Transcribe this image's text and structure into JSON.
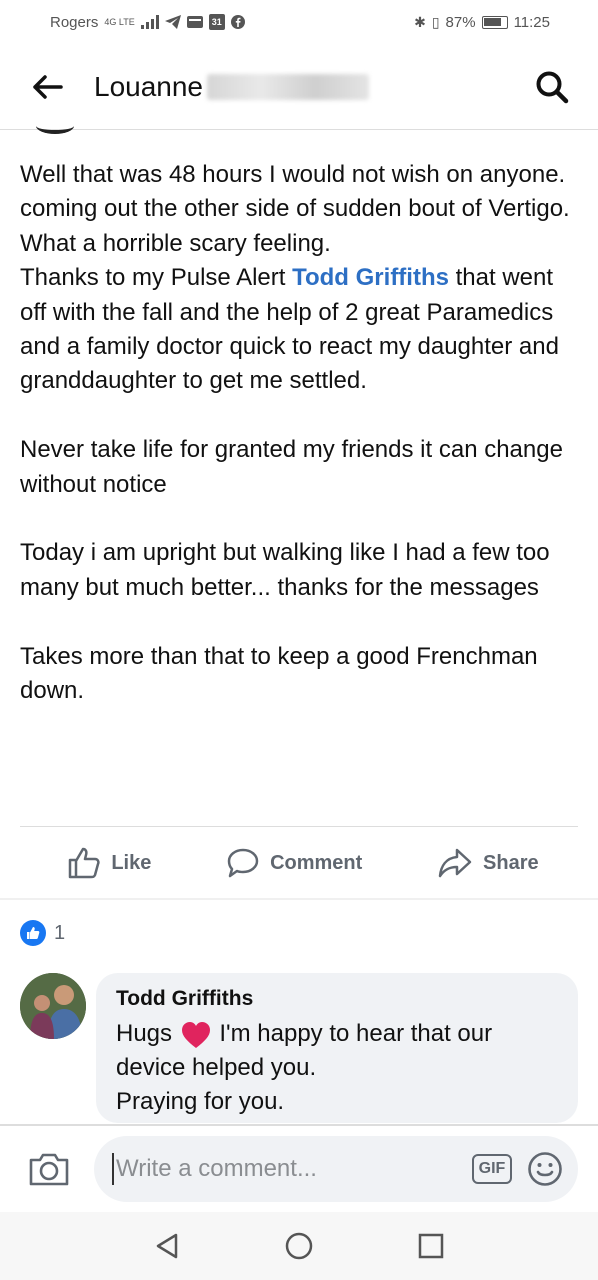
{
  "status_bar": {
    "carrier": "Rogers",
    "network": "4G LTE",
    "battery": "87%",
    "time": "11:25",
    "calendar_day": "31"
  },
  "header": {
    "title": "Louanne"
  },
  "post": {
    "paragraphs": [
      {
        "line_a": "Well that was 48 hours I would not wish on anyone. coming out the other side of sudden bout of Vertigo.",
        "line_b": "What a horrible scary feeling.",
        "line_c_before": "Thanks to my Pulse Alert ",
        "line_c_mention": "Todd Griffiths",
        "line_c_after": " that went off with the fall and the help of 2 great Paramedics and a family doctor quick to react my daughter and granddaughter to get me settled."
      },
      {
        "text": "Never take life for granted my friends it can change without notice"
      },
      {
        "text": "Today i am upright but walking like I had a few too many but much better...  thanks for the messages"
      },
      {
        "text": "Takes more than that to keep a good Frenchman down."
      }
    ]
  },
  "actions": {
    "like": "Like",
    "comment": "Comment",
    "share": "Share"
  },
  "reactions": {
    "count": "1",
    "type_icon": "like-thumb-icon"
  },
  "comment": {
    "author": "Todd Griffiths",
    "line1_before": "Hugs",
    "line1_after": "I'm happy to hear that our device helped you.",
    "line2": "Praying for you."
  },
  "composer": {
    "placeholder": "Write a comment...",
    "gif_label": "GIF"
  },
  "colors": {
    "mention": "#2d6fc4",
    "like_badge": "#1877f2",
    "bubble": "#f0f2f5",
    "heart": "#e0245e"
  }
}
